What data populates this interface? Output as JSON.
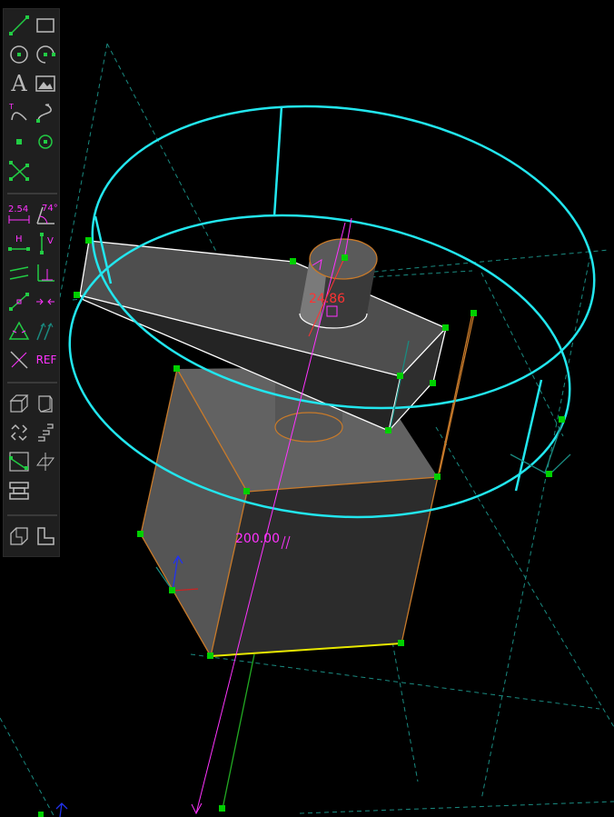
{
  "toolbar": {
    "text_tool_glyph": "A",
    "dim_length_label": "2.54",
    "dim_angle_label": "74°",
    "horizontal_label": "H",
    "vertical_label": "V",
    "ref_label": "REF"
  },
  "dimensions": {
    "diameter_value": "24.86",
    "length_value": "200.00"
  },
  "colors": {
    "toolbar_green": "#22cc44",
    "toolbar_magenta": "#ff33ff",
    "toolbar_gray": "#bbbbbb",
    "selection_cyan": "#22e6ee",
    "dimension_magenta": "#ff33ff",
    "dimension_red": "#ff3333",
    "point_green": "#00d000",
    "construction_teal": "#1a8a80",
    "edge_orange": "#c87a2a"
  },
  "icons": [
    "line-icon",
    "rectangle-icon",
    "circle-icon",
    "arc-icon",
    "text-icon",
    "image-icon",
    "tangent-arc-icon",
    "bspline-icon",
    "point-icon",
    "workplane-icon",
    "trim-icon",
    "length-dimension-icon",
    "angle-dimension-icon",
    "horizontal-constraint-icon",
    "vertical-constraint-icon",
    "parallel-constraint-icon",
    "perpendicular-constraint-icon",
    "point-on-constraint-icon",
    "symmetric-constraint-icon",
    "equal-constraint-icon",
    "tangent-constraint-icon",
    "other-constraint-icon",
    "reference-icon",
    "extrude-icon",
    "lathe-icon",
    "step-rotate-icon",
    "step-translate-icon",
    "nearest-iso-icon",
    "nearest-ortho-icon",
    "assemble-icon",
    "union-icon",
    "difference-icon"
  ]
}
